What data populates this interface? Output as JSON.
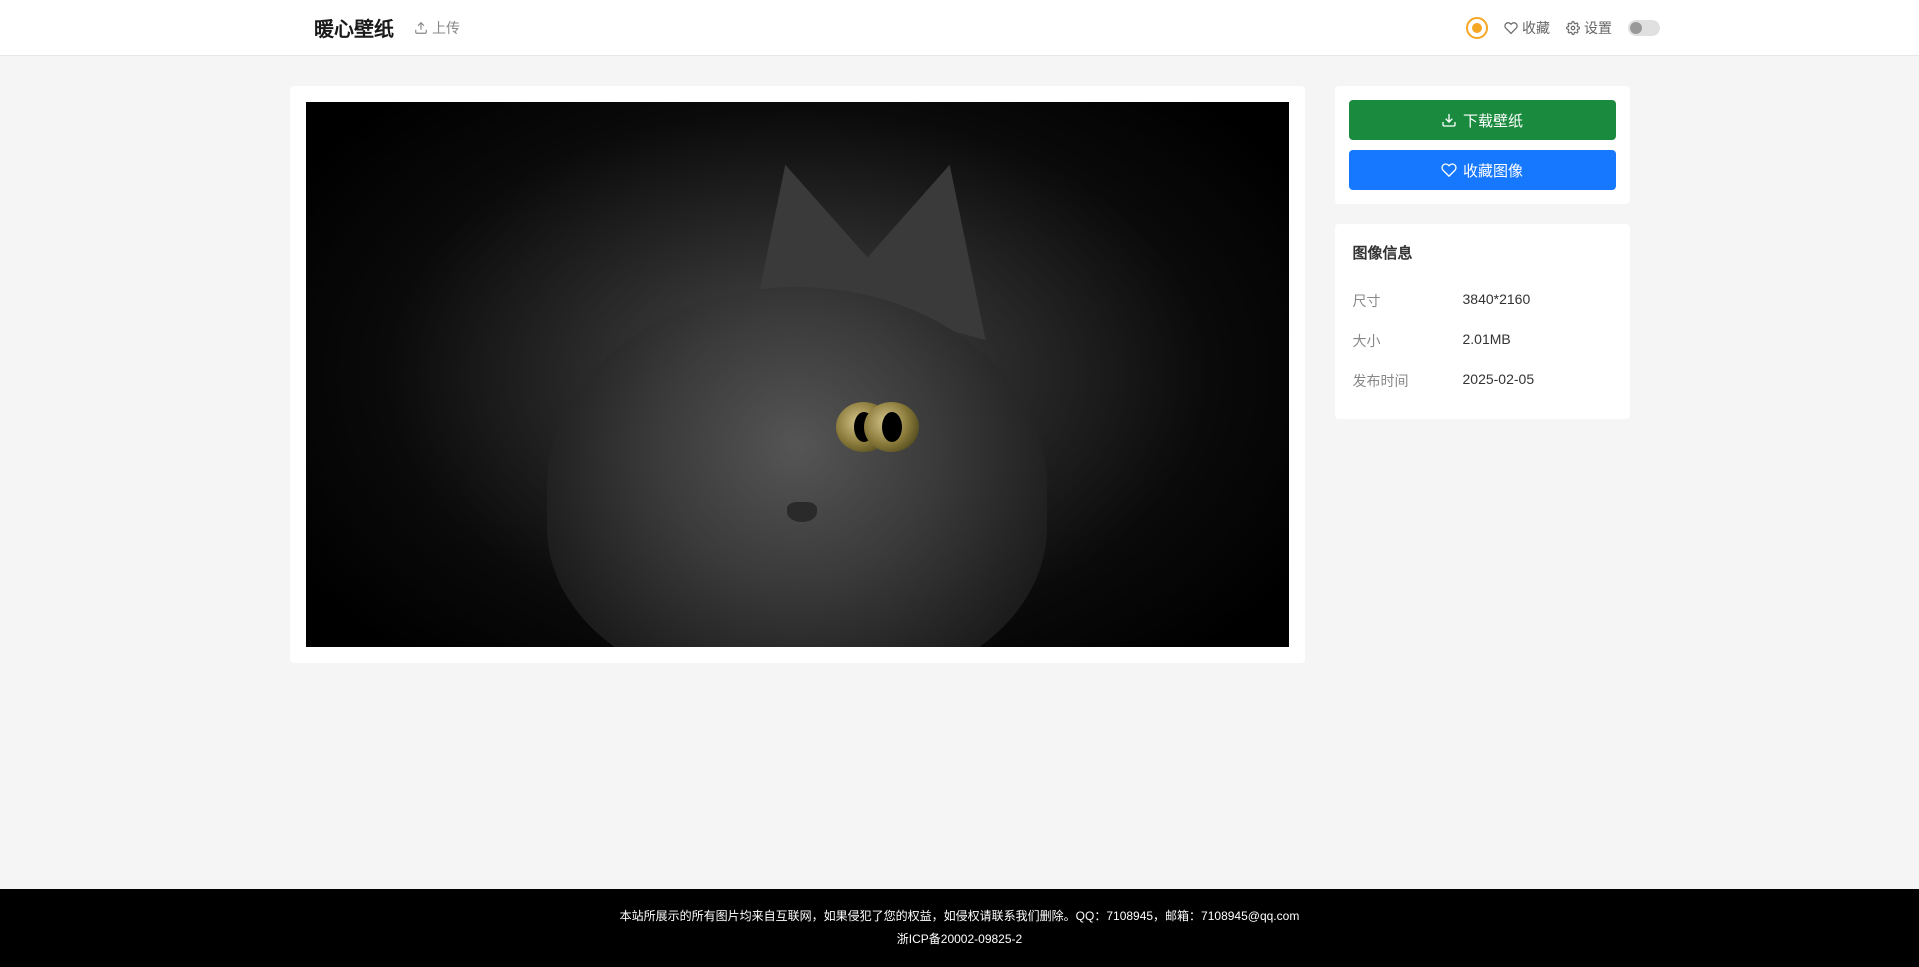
{
  "header": {
    "logo": "暖心壁纸",
    "upload_label": "上传",
    "favorites_label": "收藏",
    "settings_label": "设置"
  },
  "actions": {
    "download_label": "下载壁纸",
    "favorite_label": "收藏图像"
  },
  "info": {
    "title": "图像信息",
    "rows": [
      {
        "label": "尺寸",
        "value": "3840*2160"
      },
      {
        "label": "大小",
        "value": "2.01MB"
      },
      {
        "label": "发布时间",
        "value": "2025-02-05"
      }
    ]
  },
  "footer": {
    "disclaimer": "本站所展示的所有图片均来自互联网，如果侵犯了您的权益，如侵权请联系我们删除。QQ：7108945，邮箱：7108945@qq.com",
    "icp": "浙ICP备20002-09825-2"
  }
}
